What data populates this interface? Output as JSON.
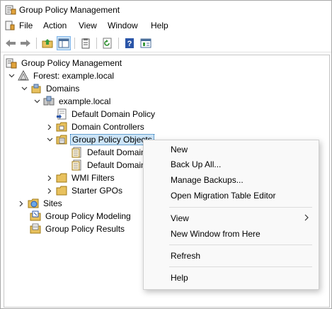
{
  "window": {
    "title": "Group Policy Management"
  },
  "menu": {
    "file": "File",
    "action": "Action",
    "view": "View",
    "window": "Window",
    "help": "Help"
  },
  "toolbar": {
    "icons": [
      "back-arrow-icon",
      "forward-arrow-icon",
      "up-folder-icon",
      "show-hide-tree-icon",
      "properties-icon",
      "refresh-icon",
      "help-icon",
      "console-icon"
    ]
  },
  "tree": {
    "root": "Group Policy Management",
    "forest": "Forest: example.local",
    "domains": "Domains",
    "domain": "example.local",
    "default_domain_policy": "Default Domain Policy",
    "domain_controllers": "Domain Controllers",
    "gpo": "Group Policy Objects",
    "gpo_child1": "Default Domain",
    "gpo_child2": "Default Domain",
    "wmi": "WMI Filters",
    "starter": "Starter GPOs",
    "sites": "Sites",
    "modeling": "Group Policy Modeling",
    "results": "Group Policy Results"
  },
  "context_menu": {
    "new": "New",
    "backup_all": "Back Up All...",
    "manage_backups": "Manage Backups...",
    "open_migration": "Open Migration Table Editor",
    "view": "View",
    "new_window": "New Window from Here",
    "refresh": "Refresh",
    "help": "Help"
  },
  "colors": {
    "selection_bg": "#cce4f7",
    "selection_border": "#0a64ad",
    "menu_bg": "#f9f9f9"
  }
}
